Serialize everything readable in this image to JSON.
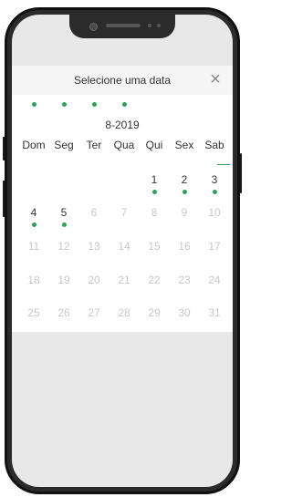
{
  "dialog": {
    "title": "Selecione uma data",
    "close_icon": "close-icon"
  },
  "calendar": {
    "month_label": "8-2019",
    "weekdays": [
      "Dom",
      "Seg",
      "Ter",
      "Qua",
      "Qui",
      "Sex",
      "Sab"
    ],
    "weeks": [
      [
        {
          "day": "",
          "state": "empty"
        },
        {
          "day": "",
          "state": "empty"
        },
        {
          "day": "",
          "state": "empty"
        },
        {
          "day": "",
          "state": "empty"
        },
        {
          "day": "1",
          "state": "available"
        },
        {
          "day": "2",
          "state": "available"
        },
        {
          "day": "3",
          "state": "available"
        }
      ],
      [
        {
          "day": "4",
          "state": "available"
        },
        {
          "day": "5",
          "state": "available"
        },
        {
          "day": "6",
          "state": "disabled"
        },
        {
          "day": "7",
          "state": "disabled"
        },
        {
          "day": "8",
          "state": "disabled"
        },
        {
          "day": "9",
          "state": "disabled"
        },
        {
          "day": "10",
          "state": "disabled"
        }
      ],
      [
        {
          "day": "11",
          "state": "disabled"
        },
        {
          "day": "12",
          "state": "disabled"
        },
        {
          "day": "13",
          "state": "disabled"
        },
        {
          "day": "14",
          "state": "disabled"
        },
        {
          "day": "15",
          "state": "disabled"
        },
        {
          "day": "16",
          "state": "disabled"
        },
        {
          "day": "17",
          "state": "disabled"
        }
      ],
      [
        {
          "day": "18",
          "state": "disabled"
        },
        {
          "day": "19",
          "state": "disabled"
        },
        {
          "day": "20",
          "state": "disabled"
        },
        {
          "day": "21",
          "state": "disabled"
        },
        {
          "day": "22",
          "state": "disabled"
        },
        {
          "day": "23",
          "state": "disabled"
        },
        {
          "day": "24",
          "state": "disabled"
        }
      ],
      [
        {
          "day": "25",
          "state": "disabled"
        },
        {
          "day": "26",
          "state": "disabled"
        },
        {
          "day": "27",
          "state": "disabled"
        },
        {
          "day": "28",
          "state": "disabled"
        },
        {
          "day": "29",
          "state": "disabled"
        },
        {
          "day": "30",
          "state": "disabled"
        },
        {
          "day": "31",
          "state": "disabled"
        }
      ]
    ],
    "previous_month_dots": 4
  },
  "colors": {
    "accent": "#2aa357",
    "text": "#333333",
    "disabled": "#c8c8c8",
    "header_bg": "#f5f5f5"
  }
}
